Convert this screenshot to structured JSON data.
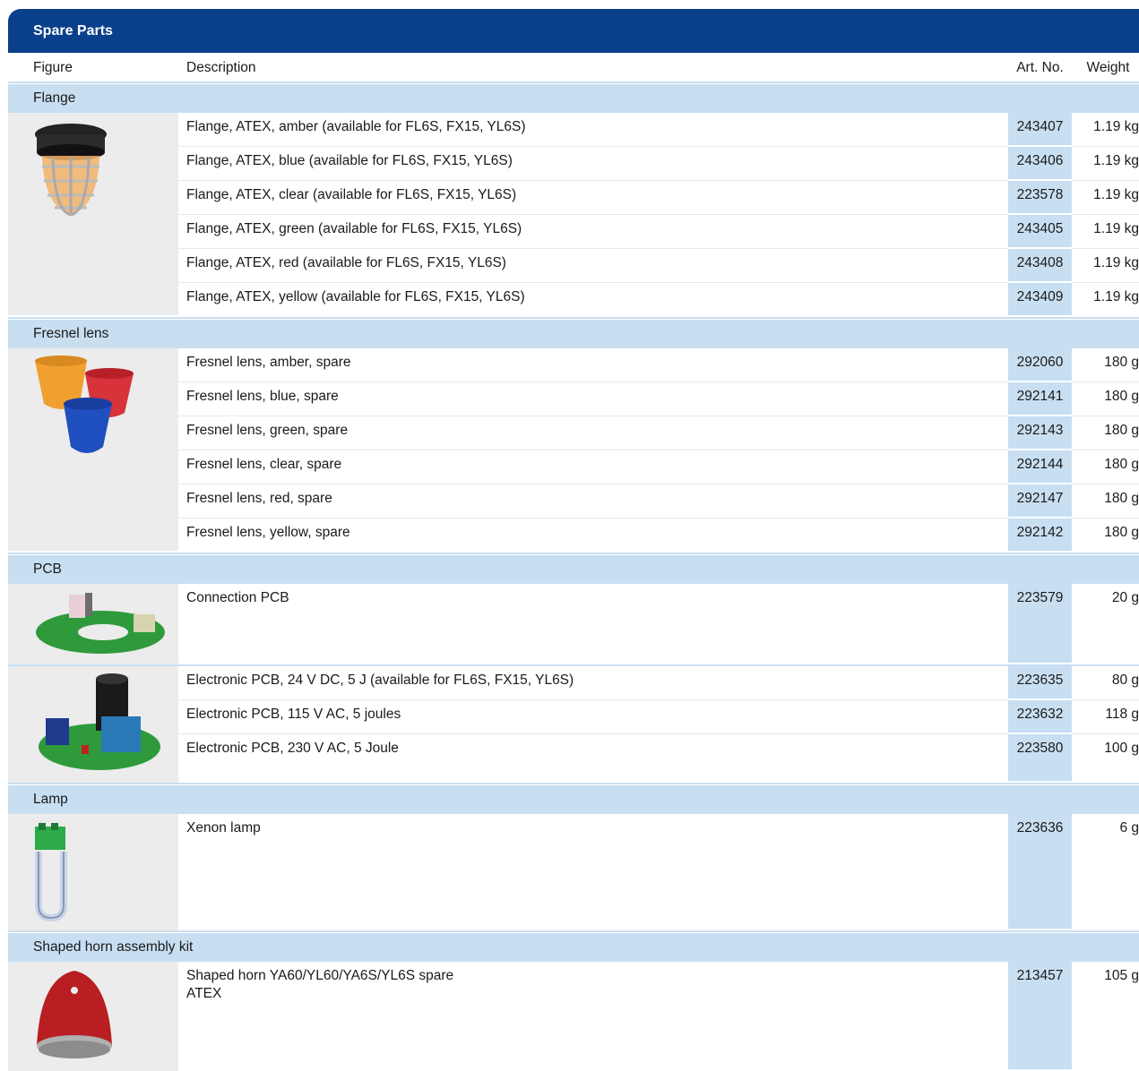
{
  "title": "Spare Parts",
  "columns": {
    "figure": "Figure",
    "description": "Description",
    "art_no": "Art. No.",
    "weight": "Weight"
  },
  "groups": [
    {
      "name": "Flange",
      "image": "flange-beacon-icon",
      "items": [
        {
          "description": "Flange, ATEX, amber (available for FL6S, FX15, YL6S)",
          "art_no": "243407",
          "weight": "1.19 kg"
        },
        {
          "description": "Flange, ATEX, blue (available for FL6S, FX15, YL6S)",
          "art_no": "243406",
          "weight": "1.19 kg"
        },
        {
          "description": "Flange, ATEX, clear (available for FL6S, FX15, YL6S)",
          "art_no": "223578",
          "weight": "1.19 kg"
        },
        {
          "description": "Flange, ATEX, green (available for FL6S, FX15, YL6S)",
          "art_no": "243405",
          "weight": "1.19 kg"
        },
        {
          "description": "Flange, ATEX, red (available for FL6S, FX15, YL6S)",
          "art_no": "243408",
          "weight": "1.19 kg"
        },
        {
          "description": "Flange, ATEX, yellow (available for FL6S, FX15, YL6S)",
          "art_no": "243409",
          "weight": "1.19 kg"
        }
      ]
    },
    {
      "name": "Fresnel lens",
      "image": "fresnel-lens-icon",
      "items": [
        {
          "description": "Fresnel lens, amber, spare",
          "art_no": "292060",
          "weight": "180 g"
        },
        {
          "description": "Fresnel lens, blue, spare",
          "art_no": "292141",
          "weight": "180 g"
        },
        {
          "description": "Fresnel lens, green, spare",
          "art_no": "292143",
          "weight": "180 g"
        },
        {
          "description": "Fresnel lens, clear, spare",
          "art_no": "292144",
          "weight": "180 g"
        },
        {
          "description": "Fresnel lens, red, spare",
          "art_no": "292147",
          "weight": "180 g"
        },
        {
          "description": "Fresnel lens, yellow, spare",
          "art_no": "292142",
          "weight": "180 g"
        }
      ]
    },
    {
      "name": "PCB",
      "image": "pcb-icon",
      "items": [
        {
          "description": "Connection PCB",
          "art_no": "223579",
          "weight": "20 g"
        },
        {
          "description": "Electronic PCB, 24 V DC, 5 J (available for FL6S, FX15, YL6S)",
          "art_no": "223635",
          "weight": "80 g"
        },
        {
          "description": "Electronic PCB, 115 V AC, 5 joules",
          "art_no": "223632",
          "weight": "118 g"
        },
        {
          "description": "Electronic PCB, 230 V AC, 5 Joule",
          "art_no": "223580",
          "weight": "100 g"
        }
      ]
    },
    {
      "name": "Lamp",
      "image": "xenon-lamp-icon",
      "items": [
        {
          "description": "Xenon lamp",
          "art_no": "223636",
          "weight": "6 g"
        }
      ]
    },
    {
      "name": "Shaped horn assembly kit",
      "image": "horn-icon",
      "items": [
        {
          "description_line1": "Shaped horn YA60/YL60/YA6S/YL6S spare",
          "description_line2": "ATEX",
          "art_no": "213457",
          "weight": "105 g"
        }
      ]
    }
  ],
  "colors": {
    "title_bar": "#0a3f8c",
    "group_bar": "#c8dff2",
    "figure_bg": "#ececec"
  }
}
